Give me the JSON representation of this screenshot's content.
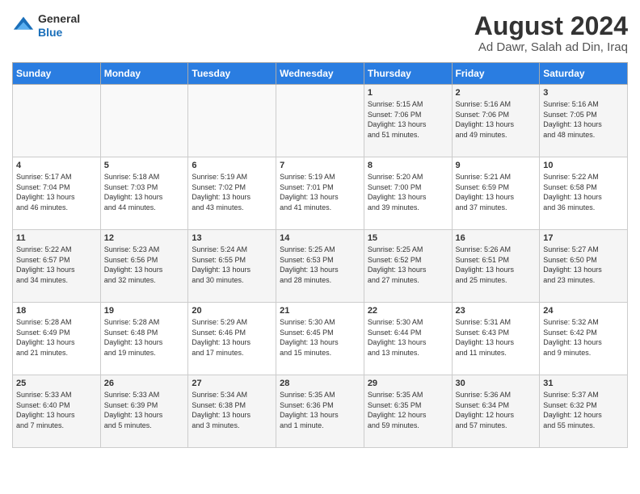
{
  "header": {
    "logo_general": "General",
    "logo_blue": "Blue",
    "title": "August 2024",
    "subtitle": "Ad Dawr, Salah ad Din, Iraq"
  },
  "weekdays": [
    "Sunday",
    "Monday",
    "Tuesday",
    "Wednesday",
    "Thursday",
    "Friday",
    "Saturday"
  ],
  "weeks": [
    [
      {
        "day": "",
        "detail": ""
      },
      {
        "day": "",
        "detail": ""
      },
      {
        "day": "",
        "detail": ""
      },
      {
        "day": "",
        "detail": ""
      },
      {
        "day": "1",
        "detail": "Sunrise: 5:15 AM\nSunset: 7:06 PM\nDaylight: 13 hours\nand 51 minutes."
      },
      {
        "day": "2",
        "detail": "Sunrise: 5:16 AM\nSunset: 7:06 PM\nDaylight: 13 hours\nand 49 minutes."
      },
      {
        "day": "3",
        "detail": "Sunrise: 5:16 AM\nSunset: 7:05 PM\nDaylight: 13 hours\nand 48 minutes."
      }
    ],
    [
      {
        "day": "4",
        "detail": "Sunrise: 5:17 AM\nSunset: 7:04 PM\nDaylight: 13 hours\nand 46 minutes."
      },
      {
        "day": "5",
        "detail": "Sunrise: 5:18 AM\nSunset: 7:03 PM\nDaylight: 13 hours\nand 44 minutes."
      },
      {
        "day": "6",
        "detail": "Sunrise: 5:19 AM\nSunset: 7:02 PM\nDaylight: 13 hours\nand 43 minutes."
      },
      {
        "day": "7",
        "detail": "Sunrise: 5:19 AM\nSunset: 7:01 PM\nDaylight: 13 hours\nand 41 minutes."
      },
      {
        "day": "8",
        "detail": "Sunrise: 5:20 AM\nSunset: 7:00 PM\nDaylight: 13 hours\nand 39 minutes."
      },
      {
        "day": "9",
        "detail": "Sunrise: 5:21 AM\nSunset: 6:59 PM\nDaylight: 13 hours\nand 37 minutes."
      },
      {
        "day": "10",
        "detail": "Sunrise: 5:22 AM\nSunset: 6:58 PM\nDaylight: 13 hours\nand 36 minutes."
      }
    ],
    [
      {
        "day": "11",
        "detail": "Sunrise: 5:22 AM\nSunset: 6:57 PM\nDaylight: 13 hours\nand 34 minutes."
      },
      {
        "day": "12",
        "detail": "Sunrise: 5:23 AM\nSunset: 6:56 PM\nDaylight: 13 hours\nand 32 minutes."
      },
      {
        "day": "13",
        "detail": "Sunrise: 5:24 AM\nSunset: 6:55 PM\nDaylight: 13 hours\nand 30 minutes."
      },
      {
        "day": "14",
        "detail": "Sunrise: 5:25 AM\nSunset: 6:53 PM\nDaylight: 13 hours\nand 28 minutes."
      },
      {
        "day": "15",
        "detail": "Sunrise: 5:25 AM\nSunset: 6:52 PM\nDaylight: 13 hours\nand 27 minutes."
      },
      {
        "day": "16",
        "detail": "Sunrise: 5:26 AM\nSunset: 6:51 PM\nDaylight: 13 hours\nand 25 minutes."
      },
      {
        "day": "17",
        "detail": "Sunrise: 5:27 AM\nSunset: 6:50 PM\nDaylight: 13 hours\nand 23 minutes."
      }
    ],
    [
      {
        "day": "18",
        "detail": "Sunrise: 5:28 AM\nSunset: 6:49 PM\nDaylight: 13 hours\nand 21 minutes."
      },
      {
        "day": "19",
        "detail": "Sunrise: 5:28 AM\nSunset: 6:48 PM\nDaylight: 13 hours\nand 19 minutes."
      },
      {
        "day": "20",
        "detail": "Sunrise: 5:29 AM\nSunset: 6:46 PM\nDaylight: 13 hours\nand 17 minutes."
      },
      {
        "day": "21",
        "detail": "Sunrise: 5:30 AM\nSunset: 6:45 PM\nDaylight: 13 hours\nand 15 minutes."
      },
      {
        "day": "22",
        "detail": "Sunrise: 5:30 AM\nSunset: 6:44 PM\nDaylight: 13 hours\nand 13 minutes."
      },
      {
        "day": "23",
        "detail": "Sunrise: 5:31 AM\nSunset: 6:43 PM\nDaylight: 13 hours\nand 11 minutes."
      },
      {
        "day": "24",
        "detail": "Sunrise: 5:32 AM\nSunset: 6:42 PM\nDaylight: 13 hours\nand 9 minutes."
      }
    ],
    [
      {
        "day": "25",
        "detail": "Sunrise: 5:33 AM\nSunset: 6:40 PM\nDaylight: 13 hours\nand 7 minutes."
      },
      {
        "day": "26",
        "detail": "Sunrise: 5:33 AM\nSunset: 6:39 PM\nDaylight: 13 hours\nand 5 minutes."
      },
      {
        "day": "27",
        "detail": "Sunrise: 5:34 AM\nSunset: 6:38 PM\nDaylight: 13 hours\nand 3 minutes."
      },
      {
        "day": "28",
        "detail": "Sunrise: 5:35 AM\nSunset: 6:36 PM\nDaylight: 13 hours\nand 1 minute."
      },
      {
        "day": "29",
        "detail": "Sunrise: 5:35 AM\nSunset: 6:35 PM\nDaylight: 12 hours\nand 59 minutes."
      },
      {
        "day": "30",
        "detail": "Sunrise: 5:36 AM\nSunset: 6:34 PM\nDaylight: 12 hours\nand 57 minutes."
      },
      {
        "day": "31",
        "detail": "Sunrise: 5:37 AM\nSunset: 6:32 PM\nDaylight: 12 hours\nand 55 minutes."
      }
    ]
  ]
}
